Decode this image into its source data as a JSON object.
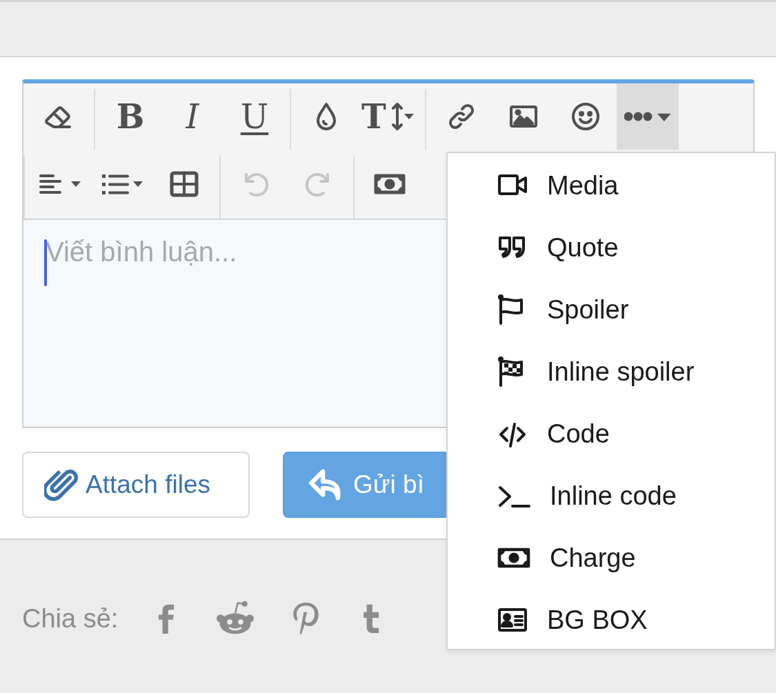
{
  "editor": {
    "toolbar": {
      "rows": [
        [
          [
            {
              "kind": "eraser",
              "disabled": false,
              "active": false
            }
          ],
          [
            {
              "kind": "bold",
              "glyph": "B",
              "disabled": false,
              "active": false
            },
            {
              "kind": "italic",
              "glyph": "I",
              "disabled": false,
              "active": false
            },
            {
              "kind": "underline",
              "glyph": "U",
              "disabled": false,
              "active": false
            }
          ],
          [
            {
              "kind": "color",
              "disabled": false,
              "active": false
            },
            {
              "kind": "font-size",
              "glyph": "T",
              "disabled": false,
              "active": false
            }
          ],
          [
            {
              "kind": "link",
              "disabled": false,
              "active": false
            },
            {
              "kind": "image",
              "disabled": false,
              "active": false
            },
            {
              "kind": "smilie",
              "disabled": false,
              "active": false
            },
            {
              "kind": "more",
              "disabled": false,
              "active": true
            }
          ]
        ],
        [
          [
            {
              "kind": "align",
              "disabled": false,
              "active": false
            },
            {
              "kind": "list",
              "disabled": false,
              "active": false
            },
            {
              "kind": "table",
              "disabled": false,
              "active": false
            }
          ],
          [
            {
              "kind": "undo",
              "disabled": true,
              "active": false
            },
            {
              "kind": "redo",
              "disabled": true,
              "active": false
            }
          ],
          [
            {
              "kind": "charge",
              "disabled": false,
              "active": false
            }
          ]
        ]
      ]
    },
    "placeholder": "Viết bình luận..."
  },
  "buttons": [
    {
      "kind": "attach",
      "label": "Attach files"
    },
    {
      "kind": "send",
      "label": "Gửi bì"
    }
  ],
  "share": {
    "label": "Chia sẻ:",
    "icons": [
      {
        "kind": "facebook"
      },
      {
        "kind": "reddit"
      },
      {
        "kind": "pinterest"
      },
      {
        "kind": "tumblr"
      }
    ]
  },
  "menu": {
    "items": [
      {
        "kind": "media",
        "label": "Media"
      },
      {
        "kind": "quote",
        "label": "Quote"
      },
      {
        "kind": "spoiler",
        "label": "Spoiler"
      },
      {
        "kind": "inline-spoiler",
        "label": "Inline spoiler"
      },
      {
        "kind": "code",
        "label": "Code"
      },
      {
        "kind": "inline-code",
        "label": "Inline code"
      },
      {
        "kind": "charge",
        "label": "Charge"
      },
      {
        "kind": "bg-box",
        "label": "BG BOX"
      }
    ]
  }
}
